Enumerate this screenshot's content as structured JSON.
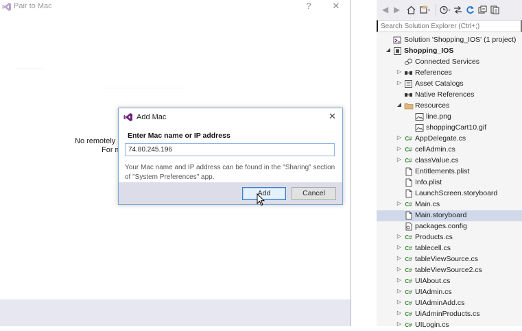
{
  "pair_window": {
    "title": "Pair to Mac",
    "help_symbol": "?",
    "close_symbol": "✕",
    "message_line1": "No remotely",
    "message_line2": "For m"
  },
  "add_mac_dialog": {
    "title": "Add Mac",
    "close_symbol": "✕",
    "label": "Enter Mac name or IP address",
    "input_value": "74.80.245.196",
    "help_text": "Your Mac name and IP address can be found in the \"Sharing\" section of \"System Preferences\" app.",
    "add_button": "Add",
    "cancel_button": "Cancel"
  },
  "solution_explorer": {
    "search_placeholder": "Search Solution Explorer (Ctrl+;)",
    "items": [
      {
        "label": "Solution 'Shopping_IOS' (1 project)",
        "icon": "solution-icon",
        "level": 0,
        "expander": ""
      },
      {
        "label": "Shopping_IOS",
        "icon": "project-icon",
        "level": 0,
        "expander": "◢",
        "bold": true
      },
      {
        "label": "Connected Services",
        "icon": "connected-services-icon",
        "level": 1,
        "expander": ""
      },
      {
        "label": "References",
        "icon": "references-icon",
        "level": 1,
        "expander": "▷"
      },
      {
        "label": "Asset Catalogs",
        "icon": "asset-catalog-icon",
        "level": 1,
        "expander": "▷"
      },
      {
        "label": "Native References",
        "icon": "references-icon",
        "level": 1,
        "expander": ""
      },
      {
        "label": "Resources",
        "icon": "folder-icon",
        "level": 1,
        "expander": "◢"
      },
      {
        "label": "line.png",
        "icon": "image-file-icon",
        "level": 2,
        "expander": ""
      },
      {
        "label": "shoppingCart10.gif",
        "icon": "image-file-icon",
        "level": 2,
        "expander": ""
      },
      {
        "label": "AppDelegate.cs",
        "icon": "csharp-file-icon",
        "level": 1,
        "expander": "▷"
      },
      {
        "label": "cellAdmin.cs",
        "icon": "csharp-file-icon",
        "level": 1,
        "expander": "▷"
      },
      {
        "label": "classValue.cs",
        "icon": "csharp-file-icon",
        "level": 1,
        "expander": "▷"
      },
      {
        "label": "Entitlements.plist",
        "icon": "file-icon",
        "level": 1,
        "expander": ""
      },
      {
        "label": "Info.plist",
        "icon": "file-icon",
        "level": 1,
        "expander": ""
      },
      {
        "label": "LaunchScreen.storyboard",
        "icon": "file-icon",
        "level": 1,
        "expander": ""
      },
      {
        "label": "Main.cs",
        "icon": "csharp-file-icon",
        "level": 1,
        "expander": "▷"
      },
      {
        "label": "Main.storyboard",
        "icon": "file-icon",
        "level": 1,
        "expander": "",
        "selected": true
      },
      {
        "label": "packages.config",
        "icon": "config-file-icon",
        "level": 1,
        "expander": ""
      },
      {
        "label": "Products.cs",
        "icon": "csharp-file-icon",
        "level": 1,
        "expander": "▷"
      },
      {
        "label": "tablecell.cs",
        "icon": "csharp-file-icon",
        "level": 1,
        "expander": "▷"
      },
      {
        "label": "tableViewSource.cs",
        "icon": "csharp-file-icon",
        "level": 1,
        "expander": "▷"
      },
      {
        "label": "tableViewSource2.cs",
        "icon": "csharp-file-icon",
        "level": 1,
        "expander": "▷"
      },
      {
        "label": "UIAbout.cs",
        "icon": "csharp-file-icon",
        "level": 1,
        "expander": "▷"
      },
      {
        "label": "UIAdmin.cs",
        "icon": "csharp-file-icon",
        "level": 1,
        "expander": "▷"
      },
      {
        "label": "UIAdminAdd.cs",
        "icon": "csharp-file-icon",
        "level": 1,
        "expander": "▷"
      },
      {
        "label": "UiAdminProducts.cs",
        "icon": "csharp-file-icon",
        "level": 1,
        "expander": "▷"
      },
      {
        "label": "UILogin.cs",
        "icon": "csharp-file-icon",
        "level": 1,
        "expander": "▷"
      }
    ]
  },
  "colors": {
    "vs_purple": "#68217a",
    "selection": "#cfd9e9",
    "csharp_green": "#368832",
    "folder_yellow": "#dcb67a"
  }
}
